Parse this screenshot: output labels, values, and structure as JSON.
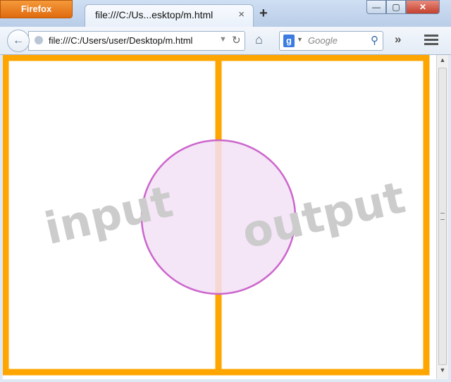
{
  "browser": {
    "app_button": "Firefox",
    "tab_title": "file:///C:/Us...esktop/m.html",
    "tab_close": "×",
    "new_tab": "+",
    "url": "file:///C:/Users/user/Desktop/m.html",
    "search_placeholder": "Google",
    "search_engine_letter": "g",
    "window_controls": {
      "minimize": "—",
      "maximize": "▢",
      "close": "✕"
    }
  },
  "icons": {
    "back": "back-arrow-icon",
    "reload": "reload-icon",
    "home": "home-icon",
    "search": "magnifier-icon",
    "overflow": "chevron-double-right-icon",
    "menu": "hamburger-menu-icon"
  },
  "page": {
    "left_label": "input",
    "right_label": "output"
  },
  "colors": {
    "border": "#FFA500",
    "circle_stroke": "#CC66CC",
    "circle_fill": "#F2E0F6",
    "label": "#CCCCCC"
  }
}
